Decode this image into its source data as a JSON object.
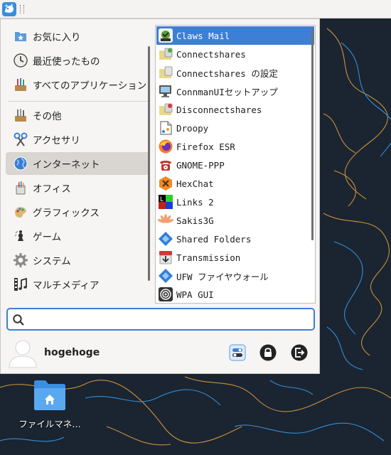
{
  "categories": [
    {
      "label": "お気に入り",
      "icon": "favorites-icon"
    },
    {
      "label": "最近使ったもの",
      "icon": "recent-clock-icon"
    },
    {
      "label": "すべてのアプリケーション",
      "icon": "all-applications-icon"
    },
    {
      "label": "その他",
      "icon": "other-icon"
    },
    {
      "label": "アクセサリ",
      "icon": "accessories-icon"
    },
    {
      "label": "インターネット",
      "icon": "internet-globe-icon",
      "active": true
    },
    {
      "label": "オフィス",
      "icon": "office-icon"
    },
    {
      "label": "グラフィックス",
      "icon": "graphics-icon"
    },
    {
      "label": "ゲーム",
      "icon": "games-icon"
    },
    {
      "label": "システム",
      "icon": "system-gear-icon"
    },
    {
      "label": "マルチメディア",
      "icon": "multimedia-icon"
    }
  ],
  "apps": [
    {
      "label": "Claws Mail",
      "icon": "claws-mail-icon",
      "selected": true
    },
    {
      "label": "Connectshares",
      "icon": "connectshares-icon"
    },
    {
      "label": "Connectshares の設定",
      "icon": "connectshares-settings-icon"
    },
    {
      "label": "ConnmanUIセットアップ",
      "icon": "connman-ui-icon"
    },
    {
      "label": "Disconnectshares",
      "icon": "disconnectshares-icon"
    },
    {
      "label": "Droopy",
      "icon": "droopy-icon"
    },
    {
      "label": "Firefox ESR",
      "icon": "firefox-icon"
    },
    {
      "label": "GNOME-PPP",
      "icon": "gnome-ppp-phone-icon"
    },
    {
      "label": "HexChat",
      "icon": "hexchat-icon"
    },
    {
      "label": "Links 2",
      "icon": "links2-icon"
    },
    {
      "label": "Sakis3G",
      "icon": "sakis3g-icon"
    },
    {
      "label": "Shared Folders",
      "icon": "shared-folders-icon"
    },
    {
      "label": "Transmission",
      "icon": "transmission-icon"
    },
    {
      "label": "UFW ファイヤウォール",
      "icon": "ufw-firewall-icon"
    },
    {
      "label": "WPA GUI",
      "icon": "wpa-gui-icon"
    }
  ],
  "search": {
    "value": "",
    "placeholder": ""
  },
  "user": {
    "name": "hogehoge"
  },
  "actions": {
    "settings": "settings-toggle-icon",
    "lock": "lock-icon",
    "logout": "logout-icon"
  },
  "desktop": {
    "icon_label": "ファイルマネ…"
  },
  "colors": {
    "accent": "#3d7fd6",
    "desktop_bg": "#1b2431"
  }
}
